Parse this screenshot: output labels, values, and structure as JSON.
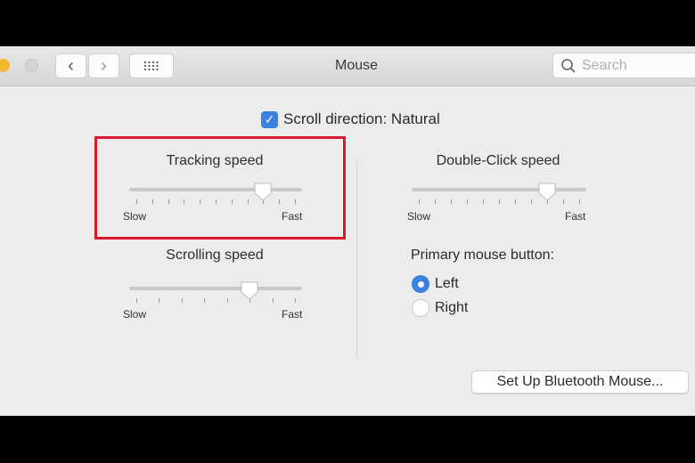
{
  "window": {
    "title": "Mouse",
    "search_placeholder": "Search"
  },
  "scroll_direction": {
    "label": "Scroll direction: Natural",
    "checked": true
  },
  "tracking": {
    "label": "Tracking speed",
    "min_label": "Slow",
    "max_label": "Fast",
    "value": 0.8,
    "ticks": 11,
    "highlighted": true
  },
  "scrolling": {
    "label": "Scrolling speed",
    "min_label": "Slow",
    "max_label": "Fast",
    "value": 0.714,
    "ticks": 8
  },
  "double_click": {
    "label": "Double-Click speed",
    "min_label": "Slow",
    "max_label": "Fast",
    "value": 0.8,
    "ticks": 11
  },
  "primary_button": {
    "label": "Primary mouse button:",
    "options": [
      {
        "label": "Left",
        "selected": true
      },
      {
        "label": "Right",
        "selected": false
      }
    ]
  },
  "bluetooth_button": "Set Up Bluetooth Mouse...",
  "colors": {
    "accent": "#3b82e0",
    "highlight": "#d9192c",
    "minimize": "#f5b731"
  }
}
